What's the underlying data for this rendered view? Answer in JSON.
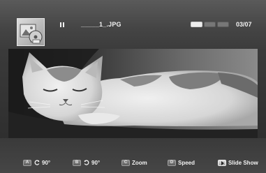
{
  "header": {
    "file_name": "_____1_.JPG",
    "page_counter": "03/07",
    "playback_state_icon": "pause-icon",
    "thumbnail_icon": "photo-disc-icon",
    "speed_indicators": [
      {
        "label": "",
        "active": true
      },
      {
        "label": "",
        "active": false
      },
      {
        "label": "",
        "active": false
      }
    ]
  },
  "photo": {
    "subject_icon": "cat-photo"
  },
  "controls": [
    {
      "key": "A",
      "icon": "rotate-left-icon",
      "label": "90°"
    },
    {
      "key": "B",
      "icon": "rotate-right-icon",
      "label": "90°"
    },
    {
      "key": "C",
      "icon": "",
      "label": "Zoom"
    },
    {
      "key": "D",
      "icon": "",
      "label": "Speed"
    },
    {
      "key": "",
      "icon": "play-icon",
      "label": "Slide Show"
    }
  ],
  "colors": {
    "text": "#f2f2f2",
    "bar_background": "#444444"
  }
}
